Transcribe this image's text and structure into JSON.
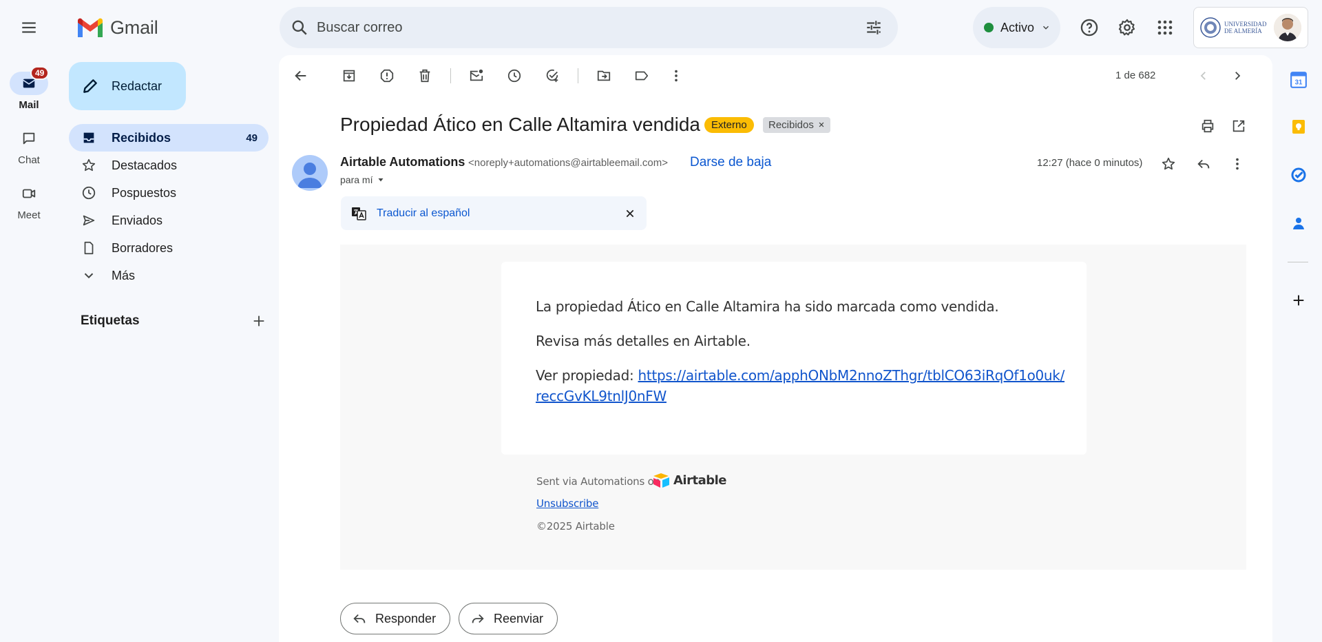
{
  "app": {
    "name": "Gmail"
  },
  "search": {
    "placeholder": "Buscar correo"
  },
  "status": {
    "label": "Activo",
    "color": "#1e8e3e"
  },
  "account": {
    "org_line1": "UNIVERSIDAD",
    "org_line2": "DE ALMERÍA"
  },
  "rail": {
    "items": [
      {
        "label": "Mail",
        "badge": "49",
        "active": true
      },
      {
        "label": "Chat"
      },
      {
        "label": "Meet"
      }
    ]
  },
  "sidebar": {
    "compose_label": "Redactar",
    "items": [
      {
        "label": "Recibidos",
        "count": "49",
        "active": true
      },
      {
        "label": "Destacados"
      },
      {
        "label": "Pospuestos"
      },
      {
        "label": "Enviados"
      },
      {
        "label": "Borradores"
      },
      {
        "label": "Más"
      }
    ],
    "labels_heading": "Etiquetas"
  },
  "toolbar": {
    "pager": "1 de 682"
  },
  "email": {
    "subject": "Propiedad Ático en Calle Altamira vendida",
    "tags": {
      "external": "Externo",
      "inbox": "Recibidos"
    },
    "sender_name": "Airtable Automations",
    "sender_email": "<noreply+automations@airtableemail.com>",
    "unsubscribe": "Darse de baja",
    "to": "para mí",
    "time": "12:27 (hace 0 minutos)",
    "translate": "Traducir al español",
    "body": {
      "line1": "La propiedad Ático en Calle Altamira ha sido marcada como vendida.",
      "line2": "Revisa más detalles en Airtable.",
      "line3_prefix": "Ver propiedad: ",
      "url_part1": "https://airtable.com/apphONbM2nnoZThgr/tblCO63iRqOf1o0uk/",
      "url_part2": "reccGvKL9tnlJ0nFW"
    },
    "footer": {
      "sent_via": "Sent via Automations on",
      "brand": "Airtable",
      "unsubscribe": "Unsubscribe",
      "copyright": "©2025 Airtable"
    }
  },
  "actions": {
    "reply": "Responder",
    "forward": "Reenviar"
  },
  "colors": {
    "accent": "#0b57d0",
    "compose_bg": "#c2e7ff",
    "active_nav": "#d3e3fd",
    "badge": "#b3261e",
    "external_tag": "#fbbc04"
  }
}
